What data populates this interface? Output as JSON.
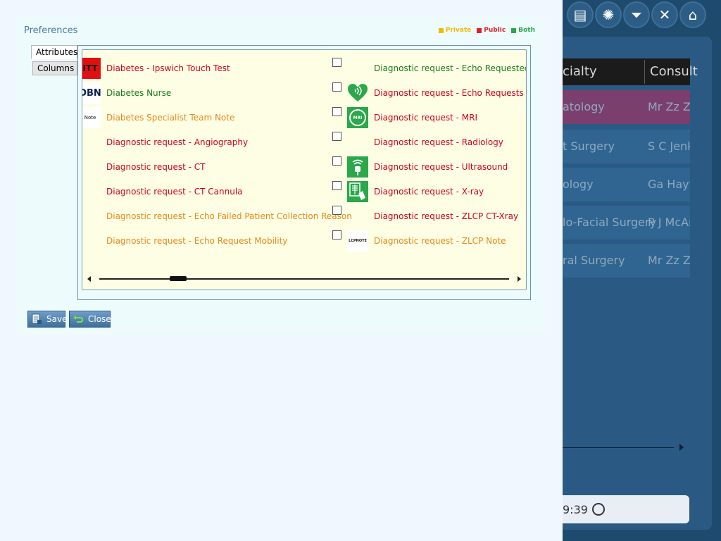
{
  "dialog": {
    "title": "Preferences",
    "legend": [
      {
        "label": "Private",
        "color": "#f5b800"
      },
      {
        "label": "Public",
        "color": "#e01e26"
      },
      {
        "label": "Both",
        "color": "#2aa84a"
      }
    ],
    "tabs": [
      {
        "label": "Attributes",
        "active": true
      },
      {
        "label": "Columns",
        "active": false
      }
    ],
    "left_items": [
      {
        "label": "Diabetes - Ipswich Touch Test",
        "color": "#d0021b",
        "icon": "ipswich-touch-test-icon",
        "icon_text": "ITT"
      },
      {
        "label": "Diabetes Nurse",
        "color": "#1a7a1a",
        "icon": "diabetes-nurse-icon",
        "icon_text": "DBN"
      },
      {
        "label": "Diabetes Specialist Team Note",
        "color": "#e8891a",
        "icon": "team-note-icon",
        "icon_text": "Note"
      },
      {
        "label": "Diagnostic request - Angiography",
        "color": "#d0021b",
        "icon": "",
        "icon_text": ""
      },
      {
        "label": "Diagnostic request - CT",
        "color": "#d0021b",
        "icon": "",
        "icon_text": ""
      },
      {
        "label": "Diagnostic request - CT Cannula",
        "color": "#d0021b",
        "icon": "",
        "icon_text": ""
      },
      {
        "label": "Diagnostic request - Echo Failed Patient Collection Reason",
        "color": "#e8891a",
        "icon": "",
        "icon_text": ""
      },
      {
        "label": "Diagnostic request - Echo Request Mobility",
        "color": "#e8891a",
        "icon": "",
        "icon_text": ""
      }
    ],
    "right_items": [
      {
        "label": "Diagnostic request - Echo Requested Dat",
        "color": "#1a7a1a",
        "icon": "",
        "icon_text": ""
      },
      {
        "label": "Diagnostic request - Echo Requests",
        "color": "#d0021b",
        "icon": "heart-echo-icon",
        "icon_text": ""
      },
      {
        "label": "Diagnostic request - MRI",
        "color": "#d0021b",
        "icon": "mri-icon",
        "icon_text": "MRI"
      },
      {
        "label": "Diagnostic request - Radiology",
        "color": "#d0021b",
        "icon": "",
        "icon_text": ""
      },
      {
        "label": "Diagnostic request - Ultrasound",
        "color": "#d0021b",
        "icon": "ultrasound-icon",
        "icon_text": ""
      },
      {
        "label": "Diagnostic request - X-ray",
        "color": "#d0021b",
        "icon": "xray-icon",
        "icon_text": ""
      },
      {
        "label": "Diagnostic request - ZLCP CT-Xray",
        "color": "#d0021b",
        "icon": "",
        "icon_text": ""
      },
      {
        "label": "Diagnostic request - ZLCP Note",
        "color": "#e8891a",
        "icon": "lcp-note-icon",
        "icon_text": "LCPNOTE"
      }
    ],
    "buttons": {
      "save": "Save",
      "close": "Close"
    }
  },
  "background": {
    "toolbar_icons": [
      "form-icon",
      "globe-icon",
      "filter-icon",
      "close-icon",
      "home-icon"
    ],
    "header": [
      "cialty",
      "Consult"
    ],
    "rows": [
      {
        "specialty": "atology",
        "consultant": "Mr Zz Zz",
        "highlight": "#9a4a7a"
      },
      {
        "specialty": "t Surgery",
        "consultant": "S C Jenk",
        "highlight": ""
      },
      {
        "specialty": "ology",
        "consultant": "Ga Hayw",
        "highlight": ""
      },
      {
        "specialty": "lo-Facial Surgery",
        "consultant": "P J McAr",
        "highlight": ""
      },
      {
        "specialty": "ral Surgery",
        "consultant": "Mr Zz Zz",
        "highlight": ""
      }
    ],
    "footer_time": "9:39"
  }
}
